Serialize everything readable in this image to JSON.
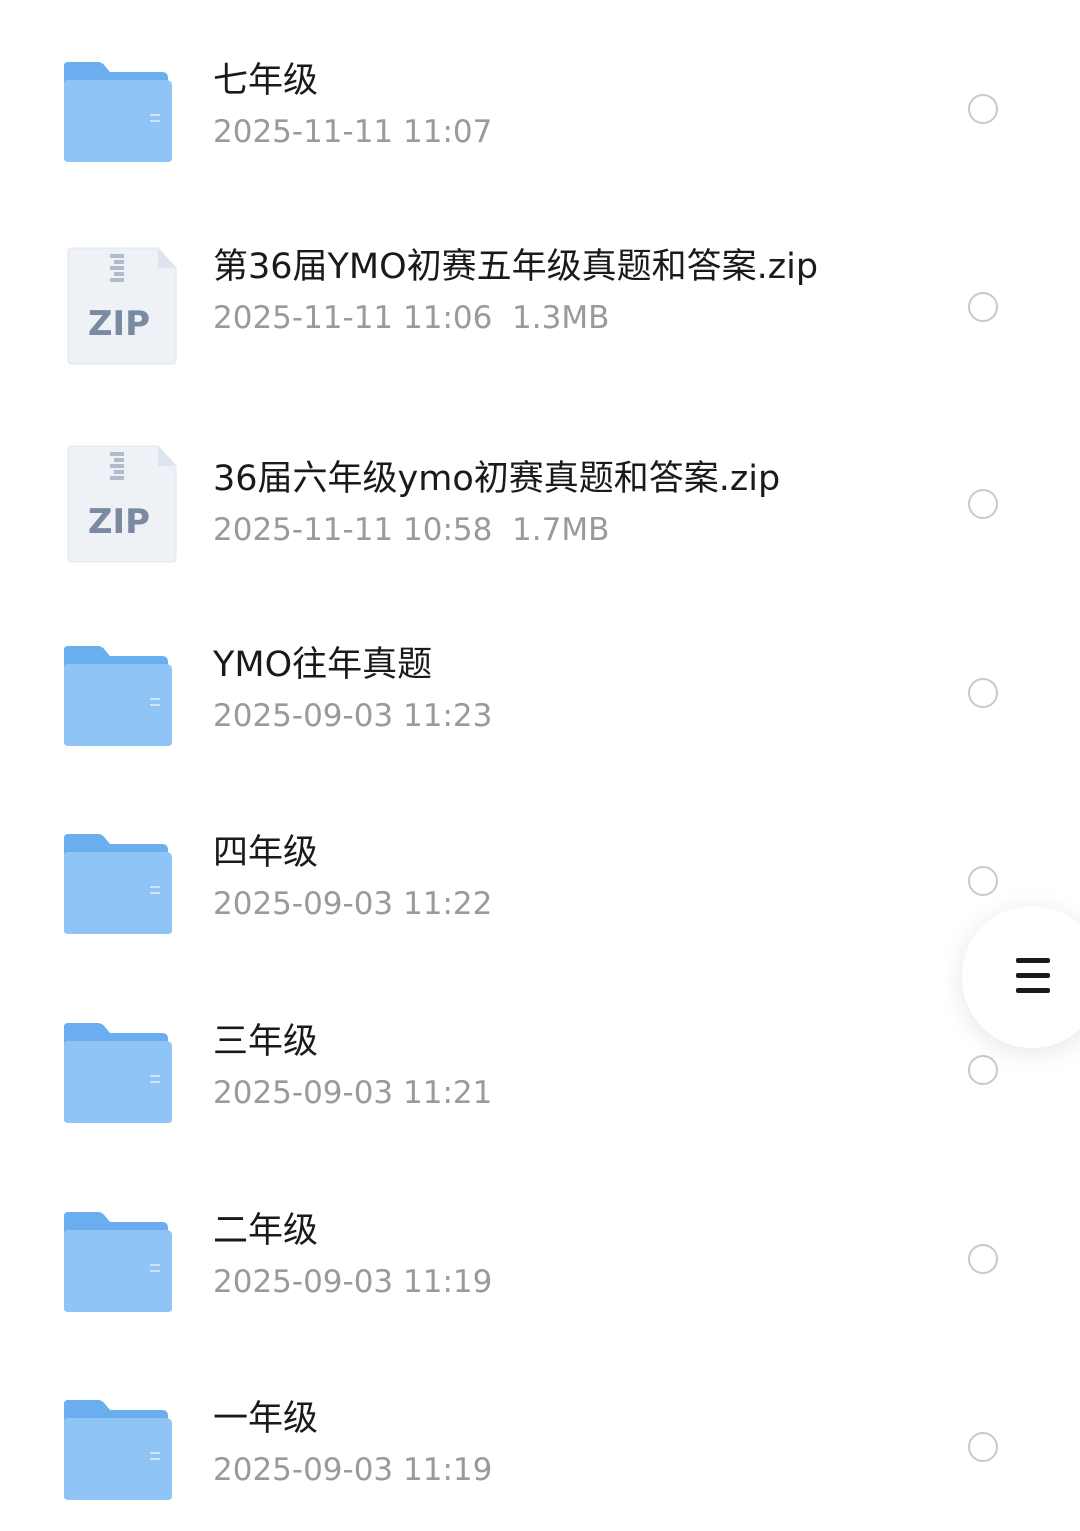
{
  "files": [
    {
      "type": "folder",
      "name": "七年级",
      "meta": "2025-11-11 11:07"
    },
    {
      "type": "zip",
      "name": "第36届YMO初赛五年级真题和答案.zip",
      "meta": "2025-11-11 11:06  1.3MB",
      "badge": "ZIP"
    },
    {
      "type": "zip",
      "name": "36届六年级ymo初赛真题和答案.zip",
      "meta": "2025-11-11 10:58  1.7MB",
      "badge": "ZIP"
    },
    {
      "type": "folder",
      "name": "YMO往年真题",
      "meta": "2025-09-03 11:23"
    },
    {
      "type": "folder",
      "name": "四年级",
      "meta": "2025-09-03 11:22"
    },
    {
      "type": "folder",
      "name": "三年级",
      "meta": "2025-09-03 11:21"
    },
    {
      "type": "folder",
      "name": "二年级",
      "meta": "2025-09-03 11:19"
    },
    {
      "type": "folder",
      "name": "一年级",
      "meta": "2025-09-03 11:19"
    }
  ],
  "colors": {
    "folder_back": "#6aaef0",
    "folder_front": "#8ec5f6",
    "zip_body": "#eef2f7",
    "zip_text": "#7a8aa0",
    "radio_border": "#c9c9c9"
  },
  "icons": {
    "folder": "folder-icon",
    "zip": "zip-archive-icon",
    "menu": "hamburger-menu-icon"
  }
}
